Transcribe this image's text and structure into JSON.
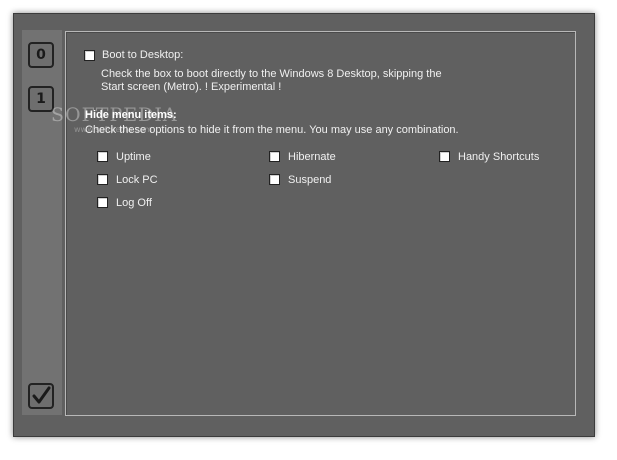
{
  "sidebar": {
    "buttons": [
      {
        "label": "0"
      },
      {
        "label": "1"
      }
    ],
    "apply_icon": "checkmark-icon"
  },
  "boot": {
    "label": "Boot to Desktop:",
    "description_line1": "Check the box to boot directly to the Windows 8 Desktop, skipping the",
    "description_line2": "Start screen (Metro). ! Experimental !",
    "checked": false
  },
  "hide_menu": {
    "heading": "Hide menu items:",
    "description": "Check these options to hide it from the menu. You may use any combination.",
    "items": [
      {
        "label": "Uptime",
        "checked": false
      },
      {
        "label": "Lock PC",
        "checked": false
      },
      {
        "label": "Log Off",
        "checked": false
      },
      {
        "label": "Hibernate",
        "checked": false
      },
      {
        "label": "Suspend",
        "checked": false
      },
      {
        "label": "Handy Shortcuts",
        "checked": false
      }
    ]
  },
  "watermark": {
    "text": "SOFTPEDIA",
    "sub": "www.softpedia.com"
  },
  "colors": {
    "window_bg": "#606060",
    "sidebar_bg": "#727272",
    "text": "#f0f0f0"
  }
}
